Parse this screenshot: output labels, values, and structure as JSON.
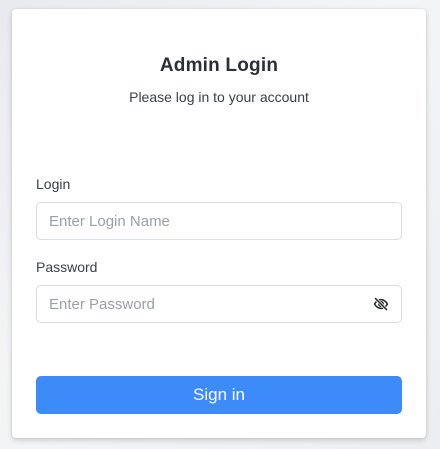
{
  "login_form": {
    "title": "Admin Login",
    "subtitle": "Please log in to your account",
    "login_label": "Login",
    "login_placeholder": "Enter Login Name",
    "login_value": "",
    "password_label": "Password",
    "password_placeholder": "Enter Password",
    "password_value": "",
    "toggle_password_icon": "eye-off-icon",
    "submit_label": "Sign in"
  },
  "colors": {
    "primary": "#3d8bf8",
    "title_text": "#2b2f36",
    "body_text": "#3a3f47",
    "placeholder": "#9aa0a8",
    "border": "#d9dce1",
    "background": "#eceef2"
  }
}
